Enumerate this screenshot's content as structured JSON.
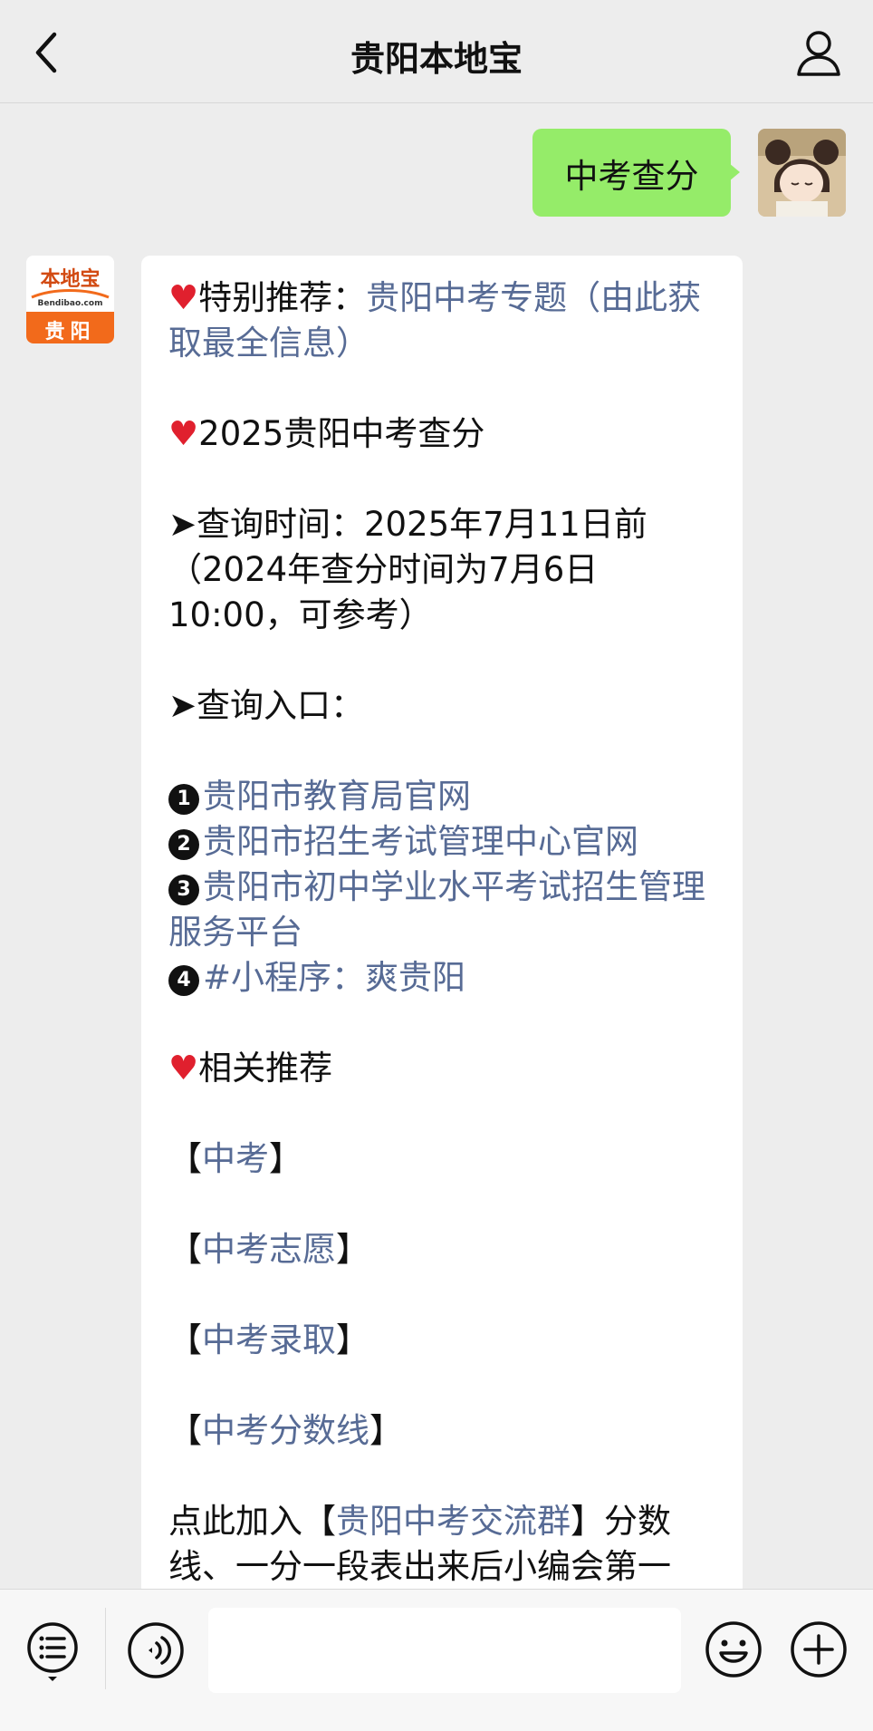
{
  "header": {
    "title": "贵阳本地宝"
  },
  "outgoing": {
    "text": "中考查分"
  },
  "bot_avatar": {
    "logo_text": "本地宝",
    "logo_sub": "Bendibao.com",
    "city": "贵阳"
  },
  "message": {
    "p1_prefix": "特别推荐：",
    "p1_link": "贵阳中考专题（由此获取最全信息）",
    "p2_text": "2025贵阳中考查分",
    "p3_text": "➤查询时间：2025年7月11日前（2024年查分时间为7月6日10:00，可参考）",
    "p4_text": "➤查询入口：",
    "entries": [
      {
        "num": "1",
        "text": "贵阳市教育局官网"
      },
      {
        "num": "2",
        "text": "贵阳市招生考试管理中心官网"
      },
      {
        "num": "3",
        "text": "贵阳市初中学业水平考试招生管理服务平台"
      },
      {
        "num": "4",
        "text": "#小程序：爽贵阳"
      }
    ],
    "related_title": "相关推荐",
    "related": [
      "中考",
      "中考志愿",
      "中考录取",
      "中考分数线"
    ],
    "bracket_open": "【",
    "bracket_close": "】",
    "join_prefix": "点此加入",
    "join_link": "贵阳中考交流群",
    "join_suffix": "分数线、一分一段表出来后小编会第一"
  },
  "icons": {
    "back": "chevron-left-icon",
    "profile": "person-icon",
    "menu": "list-menu-icon",
    "voice": "voice-icon",
    "emoji": "smiley-icon",
    "plus": "plus-circle-icon"
  },
  "colors": {
    "link": "#576b95",
    "outgoing_bubble": "#95ec69",
    "heart": "#e0202e",
    "logo_orange": "#f26a1b"
  }
}
